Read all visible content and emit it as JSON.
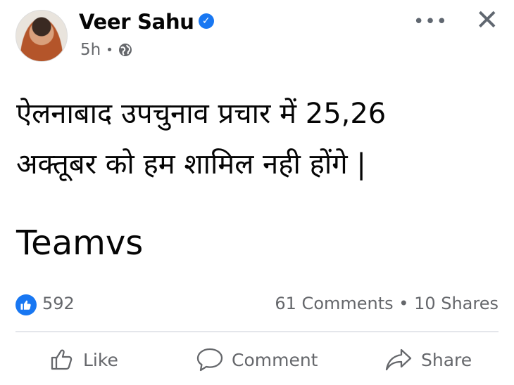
{
  "post": {
    "author": "Veer Sahu",
    "time": "5h",
    "privacy_icon": "globe-icon",
    "text": "ऐलनाबाद उपचुनाव प्रचार में 25,26\nअक्तूबर को हम शामिल नही होंगे |",
    "signature": "Teamvs"
  },
  "stats": {
    "likes": "592",
    "comments_shares": "61 Comments • 10 Shares"
  },
  "actions": {
    "like": "Like",
    "comment": "Comment",
    "share": "Share"
  },
  "colors": {
    "accent": "#1877f2",
    "secondary_text": "#65676b",
    "divider": "#e4e6eb"
  }
}
